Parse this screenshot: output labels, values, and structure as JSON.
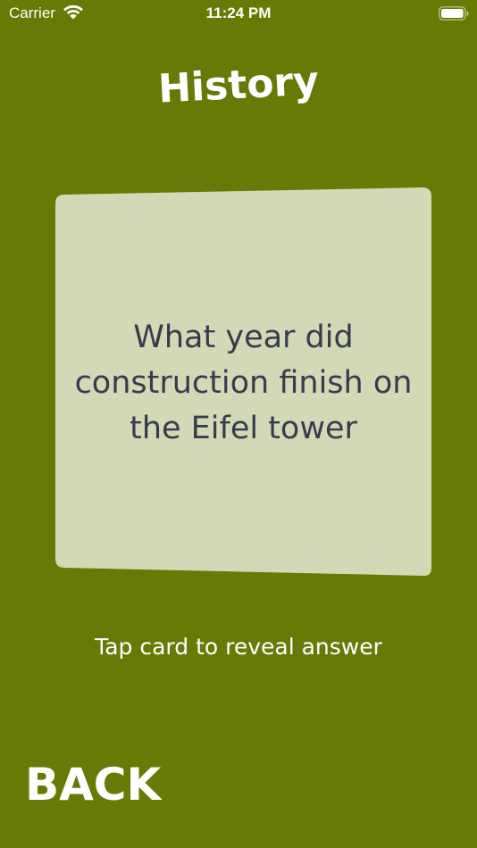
{
  "status_bar": {
    "carrier": "Carrier",
    "time": "11:24 PM",
    "wifi_icon": "wifi-icon",
    "battery_icon": "battery-icon"
  },
  "title": "History",
  "card": {
    "question": "What year did\nconstruction finish on\nthe Eifel tower"
  },
  "hint": "Tap card to reveal answer",
  "back_label": "BACK",
  "colors": {
    "background": "#677a06",
    "card": "#d3d9b6",
    "card_text": "#373b4e"
  }
}
